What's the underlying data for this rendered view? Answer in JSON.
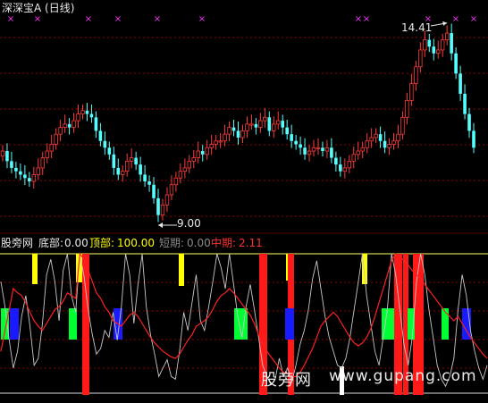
{
  "colors": {
    "background": "#000000",
    "up_candle": "#ff3b3b",
    "down_candle": "#54ffff",
    "gridline": "#8b0000",
    "marker": "#ff33ff",
    "white_line": "#c8c8c8",
    "red_line": "#ff2020",
    "red_bar": "#ff1a1a",
    "yellow_bar": "#ffff00",
    "green_bar": "#00ff33",
    "blue_bar": "#1a1aff",
    "white_bar": "#ffffff"
  },
  "header": {
    "title": "深深宝A (日线)",
    "high_label": "14.41",
    "low_label": "9.00"
  },
  "indicator_header": {
    "name": "股旁网",
    "bottom_label": "底部:",
    "bottom_value": "0.00",
    "top_label": "顶部:",
    "top_value": "100.00",
    "short_label": "短期:",
    "short_value": "0.00",
    "mid_label": "中期:",
    "mid_value": "2.11"
  },
  "watermark": {
    "cn": "股旁网",
    "url": "www.gupang.com"
  },
  "chart_data": [
    {
      "type": "candlestick",
      "title": "深深宝A (日线)",
      "annotations": [
        {
          "text": "14.41",
          "kind": "high"
        },
        {
          "text": "9.00",
          "kind": "low"
        }
      ],
      "close": [
        10.9,
        10.6,
        10.4,
        10.3,
        10.2,
        10.1,
        10.0,
        10.2,
        10.4,
        10.7,
        10.9,
        11.1,
        11.4,
        11.6,
        11.7,
        11.6,
        11.8,
        12.0,
        12.1,
        12.0,
        11.9,
        11.5,
        11.2,
        11.0,
        10.8,
        10.4,
        10.2,
        10.3,
        10.6,
        10.7,
        10.5,
        10.2,
        10.0,
        9.9,
        9.5,
        9.0,
        9.3,
        9.6,
        9.9,
        10.1,
        10.3,
        10.4,
        10.6,
        10.7,
        10.9,
        10.8,
        11.0,
        11.1,
        11.2,
        11.2,
        11.4,
        11.6,
        11.5,
        11.3,
        11.5,
        11.7,
        11.7,
        11.6,
        11.8,
        11.9,
        11.5,
        11.7,
        11.8,
        11.6,
        11.4,
        11.2,
        11.1,
        11.0,
        10.8,
        10.9,
        11.0,
        11.0,
        10.9,
        11.0,
        10.7,
        10.5,
        10.3,
        10.4,
        10.6,
        10.8,
        10.9,
        11.0,
        11.2,
        11.3,
        11.4,
        11.2,
        11.0,
        11.1,
        11.2,
        11.4,
        11.9,
        12.4,
        12.9,
        13.4,
        13.9,
        14.2,
        14.0,
        13.8,
        13.9,
        14.2,
        14.4,
        13.8,
        13.2,
        12.6,
        12.0,
        11.5,
        11.0
      ]
    },
    {
      "type": "line",
      "title": "",
      "ylim": [
        0,
        100
      ],
      "series": [
        {
          "name": "短期",
          "color": "#c8c8c8",
          "values": [
            80,
            62,
            38,
            18,
            30,
            55,
            70,
            48,
            20,
            25,
            50,
            85,
            96,
            80,
            52,
            88,
            100,
            70,
            58,
            100,
            84,
            60,
            42,
            28,
            32,
            45,
            40,
            58,
            38,
            62,
            100,
            85,
            50,
            78,
            100,
            62,
            42,
            28,
            12,
            18,
            24,
            12,
            10,
            30,
            58,
            45,
            65,
            85,
            52,
            45,
            62,
            80,
            100,
            90,
            75,
            100,
            78,
            55,
            40,
            62,
            78,
            60,
            40,
            20,
            12,
            6,
            10,
            25,
            12,
            18,
            8,
            20,
            35,
            45,
            60,
            82,
            95,
            75,
            55,
            40,
            30,
            20,
            18,
            25,
            40,
            60,
            80,
            100,
            70,
            50,
            30,
            20,
            40,
            60,
            100,
            85,
            60,
            35,
            20,
            40,
            80,
            100,
            85,
            60,
            40,
            20,
            10,
            5,
            12,
            25,
            60,
            85,
            70,
            45,
            30,
            18,
            10,
            20
          ]
        },
        {
          "name": "中期",
          "color": "#ff2020",
          "values": [
            30,
            45,
            60,
            75,
            72,
            70,
            65,
            58,
            52,
            48,
            45,
            50,
            55,
            60,
            62,
            66,
            72,
            70,
            68,
            100,
            96,
            88,
            80,
            72,
            68,
            62,
            58,
            52,
            50,
            48,
            52,
            56,
            58,
            55,
            50,
            45,
            40,
            36,
            33,
            30,
            28,
            26,
            25,
            28,
            33,
            38,
            42,
            48,
            50,
            52,
            55,
            60,
            66,
            70,
            72,
            75,
            72,
            68,
            64,
            60,
            56,
            50,
            42,
            35,
            30,
            26,
            22,
            18,
            15,
            14,
            12,
            12,
            15,
            20,
            26,
            32,
            40,
            48,
            52,
            55,
            58,
            55,
            50,
            45,
            40,
            36,
            34,
            36,
            40,
            46,
            55,
            65,
            75,
            85,
            95,
            100,
            98,
            95,
            92,
            88,
            85,
            82,
            78,
            74,
            70,
            66,
            62,
            58,
            55,
            52,
            55,
            50,
            45,
            40,
            36,
            32,
            28,
            25
          ]
        }
      ]
    }
  ]
}
